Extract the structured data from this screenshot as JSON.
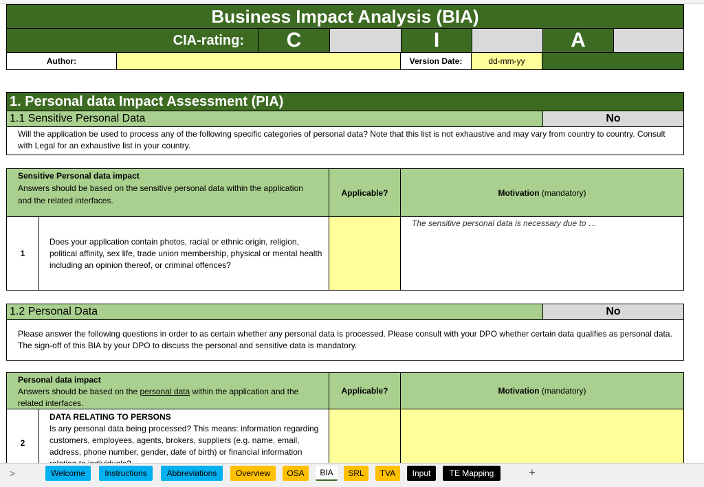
{
  "header": {
    "title": "Business Impact Analysis (BIA)",
    "cia_label": "CIA-rating:",
    "cia_c": "C",
    "cia_i": "I",
    "cia_a": "A",
    "author_label": "Author:",
    "author_value": "",
    "version_label": "Version Date:",
    "version_value": "dd-mm-yy"
  },
  "section1": {
    "title": "1. Personal data Impact Assessment (PIA)",
    "sub1_title": "1.1 Sensitive Personal Data",
    "sub1_answer": "No",
    "sub1_desc": "Will the application be used to process any of the following specific categories of personal data? Note that this list is not exhaustive and may vary from country to country. Consult with Legal for an exhaustive list in your country."
  },
  "table1": {
    "head_title": "Sensitive Personal data impact",
    "head_desc": "Answers should be based on the sensitive personal data within the application and the related interfaces.",
    "applicable_label": "Applicable?",
    "motivation_label": "Motivation",
    "motivation_suffix": "(mandatory)",
    "row_num": "1",
    "row_question": "Does your application contain photos, racial or ethnic origin, religion, political affinity, sex life, trade union membership, physical or mental health including an opinion thereof, or criminal offences?",
    "row_motivation": "The sensitive personal data is necessary due to …"
  },
  "section12": {
    "title": "1.2 Personal Data",
    "answer": "No",
    "desc": "Please answer the following questions in order to as certain whether any personal data is processed. Please consult with your DPO whether certain data qualifies as personal data. The sign-off of this BIA by your DPO to discuss the personal and sensitive data is mandatory."
  },
  "table2": {
    "head_title": "Personal data impact",
    "head_desc_before": "Answers should be based on the ",
    "head_desc_link": "personal data",
    "head_desc_after": " within the application and the related interfaces.",
    "applicable_label": "Applicable?",
    "motivation_label": "Motivation",
    "motivation_suffix": "(mandatory)",
    "row_num": "2",
    "row_title": "DATA RELATING TO PERSONS",
    "row_question": "Is any personal data being processed? This means: information regarding customers, employees, agents, brokers, suppliers (e.g. name, email, address, phone number, gender, date of birth) or financial information relating to individuals?"
  },
  "sheet_tabs": {
    "nav_arrow": ">",
    "add": "+",
    "tabs": [
      "Welcome",
      "Instructions",
      "Abbreviations",
      "Overview",
      "OSA",
      "BIA",
      "SRL",
      "TVA",
      "Input",
      "TE Mapping"
    ]
  }
}
